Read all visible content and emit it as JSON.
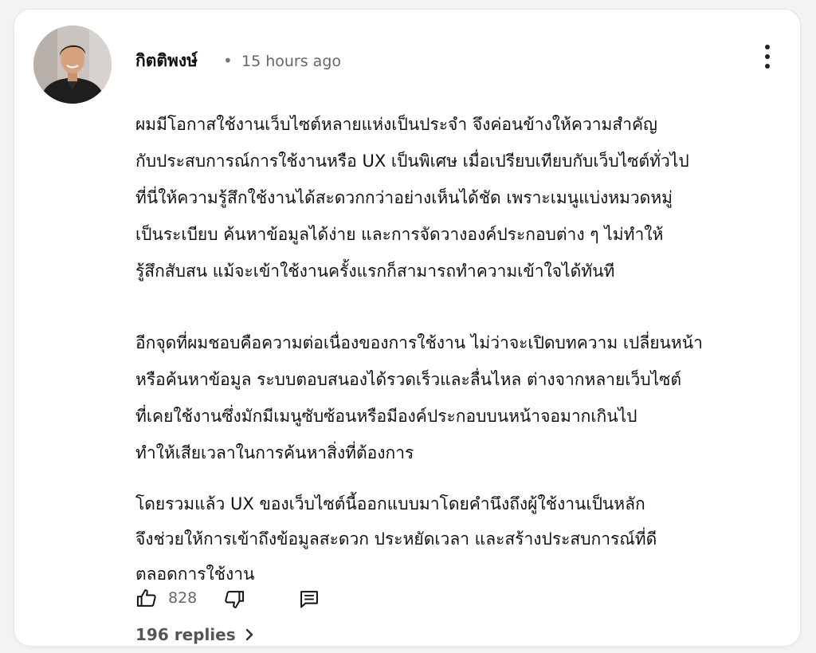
{
  "comment": {
    "author": "กิตติพงษ์",
    "separator": "•",
    "time": "15 hours ago",
    "paragraphs": [
      [
        "ผมมีโอกาสใช้งานเว็บไซต์หลายแห่งเป็นประจำ จึงค่อนข้างให้ความสำคัญ",
        "กับประสบการณ์การใช้งานหรือ UX เป็นพิเศษ เมื่อเปรียบเทียบกับเว็บไซต์ทั่วไป",
        "ที่นี่ให้ความรู้สึกใช้งานได้สะดวกกว่าอย่างเห็นได้ชัด เพราะเมนูแบ่งหมวดหมู่",
        "เป็นระเบียบ ค้นหาข้อมูลได้ง่าย และการจัดวางองค์ประกอบต่าง ๆ ไม่ทำให้",
        "รู้สึกสับสน แม้จะเข้าใช้งานครั้งแรกก็สามารถทำความเข้าใจได้ทันที"
      ],
      [
        "อีกจุดที่ผมชอบคือความต่อเนื่องของการใช้งาน ไม่ว่าจะเปิดบทความ เปลี่ยนหน้า",
        "หรือค้นหาข้อมูล ระบบตอบสนองได้รวดเร็วและลื่นไหล ต่างจากหลายเว็บไซต์",
        "ที่เคยใช้งานซึ่งมักมีเมนูซับซ้อนหรือมีองค์ประกอบบนหน้าจอมากเกินไป",
        "ทำให้เสียเวลาในการค้นหาสิ่งที่ต้องการ"
      ],
      [
        "โดยรวมแล้ว UX ของเว็บไซต์นี้ออกแบบมาโดยคำนึงถึงผู้ใช้งานเป็นหลัก",
        "จึงช่วยให้การเข้าถึงข้อมูลสะดวก ประหยัดเวลา และสร้างประสบการณ์ที่ดี",
        "ตลอดการใช้งาน"
      ]
    ],
    "likes": "828",
    "replies": "196 replies"
  },
  "icons": {
    "more": "more-vert-icon",
    "like": "thumbs-up-icon",
    "dislike": "thumbs-down-icon",
    "reply": "reply-icon",
    "chevron": "chevron-right-icon"
  },
  "colors": {
    "text": "#111111",
    "muted": "#666666"
  }
}
